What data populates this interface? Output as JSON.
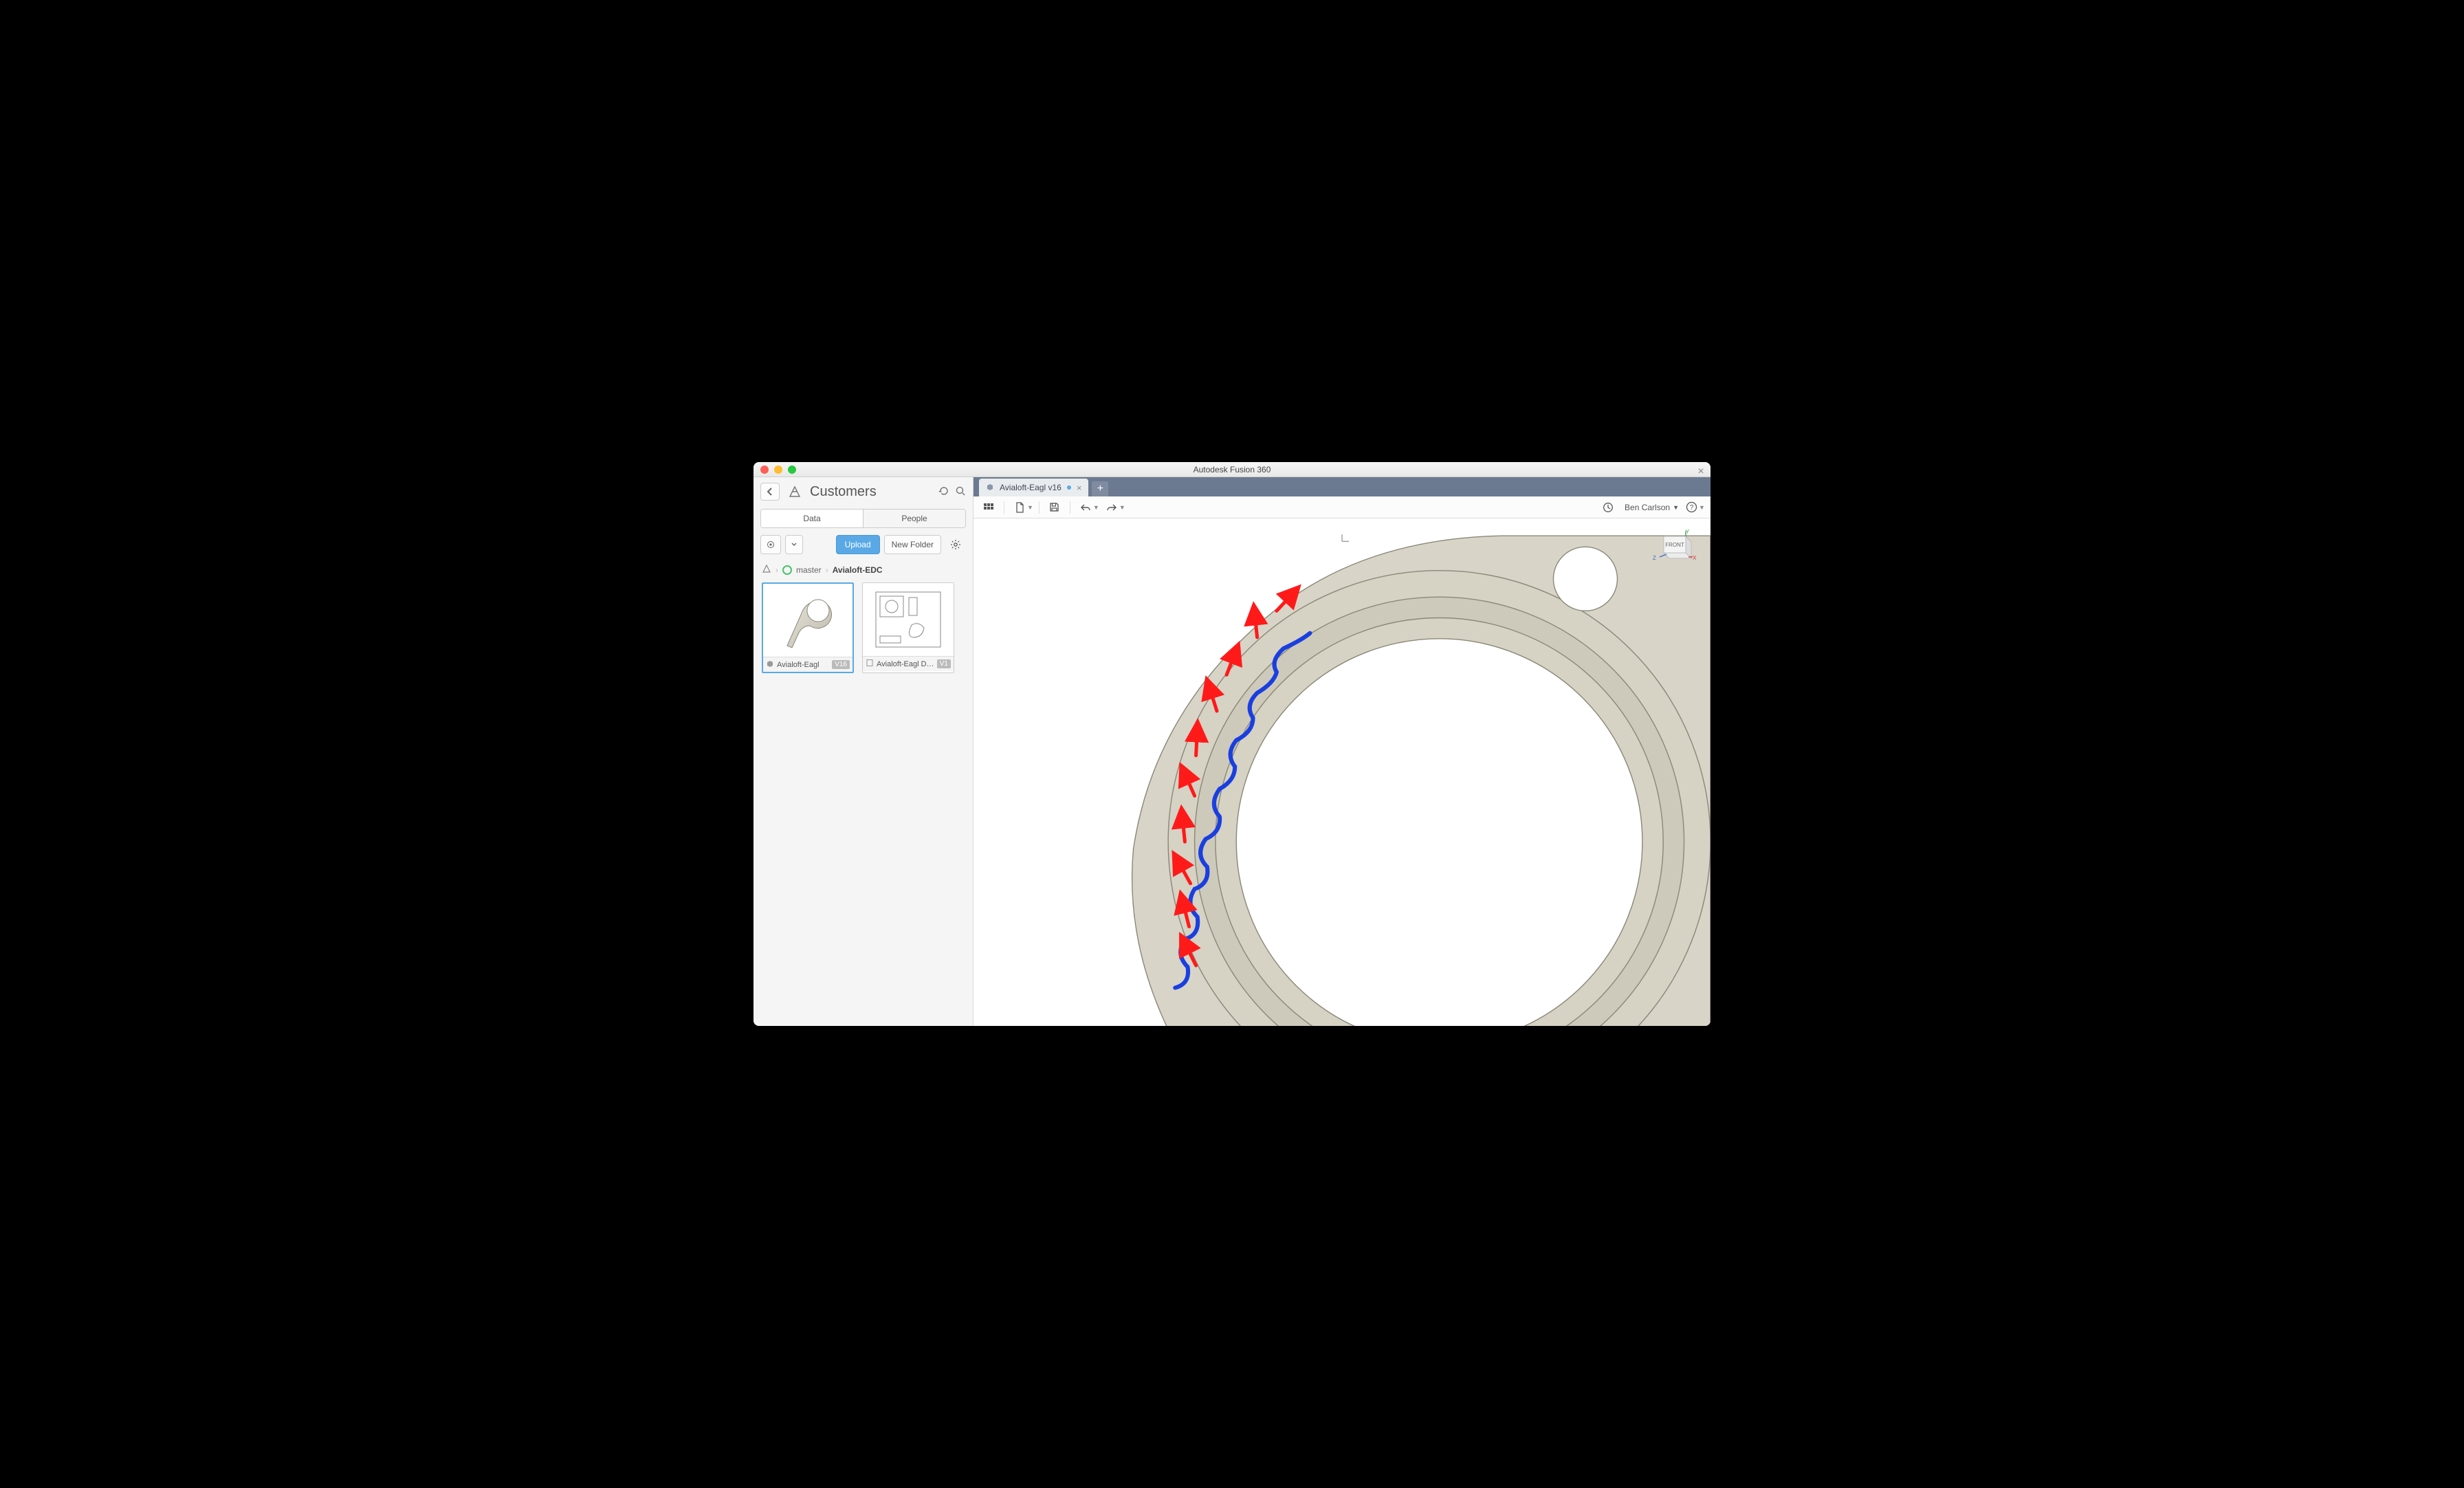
{
  "app": {
    "title": "Autodesk Fusion 360"
  },
  "datapanel": {
    "project_name": "Customers",
    "tabs": {
      "data": "Data",
      "people": "People",
      "active": "data"
    },
    "buttons": {
      "upload": "Upload",
      "new_folder": "New Folder"
    },
    "breadcrumb": {
      "branch": "master",
      "folder": "Avialoft-EDC"
    },
    "items": [
      {
        "name": "Avialoft-Eagl",
        "version": "V16",
        "type": "model",
        "active": true
      },
      {
        "name": "Avialoft-Eagl Dra...",
        "version": "V1",
        "type": "drawing",
        "active": false
      }
    ]
  },
  "tabs": [
    {
      "label": "Avialoft-Eagl v16",
      "dirty": true,
      "active": true
    }
  ],
  "toolbar_right": {
    "user": "Ben Carlson"
  },
  "viewcube": {
    "face": "FRONT",
    "axes": {
      "x": "X",
      "y": "Y",
      "z": "Z"
    }
  },
  "canvas": {
    "selection_color": "#1a3fe0",
    "annotation_color": "#ff1a1a",
    "part_fill": "#d6d2c4",
    "part_edge": "#8a8878",
    "description": "Flange/ring part with scalloped inner-left edge selected (blue). Red arrows indicate offset/normal direction along the scalloped edge."
  }
}
